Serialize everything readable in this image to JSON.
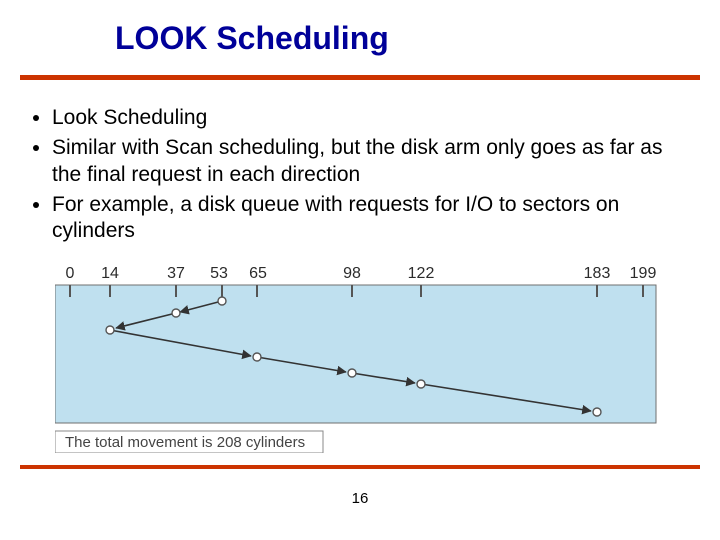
{
  "title": "LOOK Scheduling",
  "bullets": [
    "Look Scheduling",
    "Similar with Scan scheduling, but the disk arm only goes as far as the final request in each direction",
    "For example, a disk queue with requests for I/O to sectors on cylinders"
  ],
  "page_number": "16",
  "chart_data": {
    "type": "line",
    "title": "",
    "xlabel": "",
    "ylabel": "",
    "xlim": [
      0,
      199
    ],
    "ticks": [
      0,
      14,
      37,
      53,
      65,
      98,
      122,
      183,
      199
    ],
    "sequence": [
      53,
      37,
      14,
      65,
      98,
      122,
      183
    ],
    "caption": "The total movement is 208 cylinders"
  }
}
